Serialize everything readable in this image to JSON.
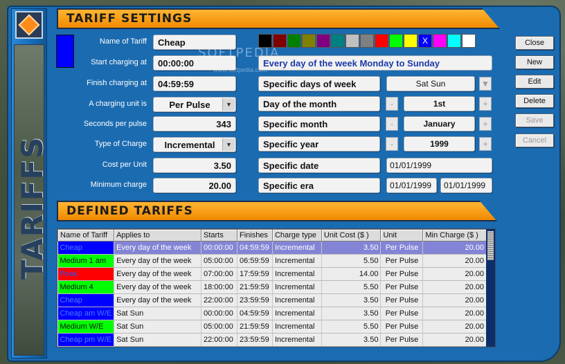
{
  "settings": {
    "title": "TARIFF SETTINGS",
    "labels": {
      "name": "Name of Tariff",
      "start": "Start charging at",
      "finish": "Finish charging at",
      "unit": "A charging unit is",
      "seconds": "Seconds per pulse",
      "type": "Type of Charge",
      "cost": "Cost per Unit",
      "min": "Minimum charge"
    },
    "values": {
      "name": "Cheap",
      "start": "00:00:00",
      "finish": "04:59:59",
      "unit": "Per Pulse",
      "seconds": "343",
      "type": "Incremental",
      "cost": "3.50",
      "min": "20.00"
    },
    "selected_color": "#0000ff",
    "colors": [
      "#000000",
      "#800000",
      "#008000",
      "#808000",
      "#800080",
      "#008080",
      "#c0c0c0",
      "#808080",
      "#ff0000",
      "#00ff00",
      "#ffff00",
      "#0000ff",
      "#ff00ff",
      "#00ffff",
      "#ffffff"
    ],
    "selected_color_mark": "X",
    "days_summary": "Every day of the week Monday to Sunday",
    "options": {
      "days_of_week": "Specific days of week",
      "day_of_month": "Day of the month",
      "month": "Specific month",
      "year": "Specific year",
      "date": "Specific date",
      "era": "Specific era"
    },
    "option_values": {
      "days_of_week": "Sat Sun",
      "day_of_month": "1st",
      "month": "January",
      "year": "1999",
      "date": "01/01/1999",
      "era_from": "01/01/1999",
      "era_to": "01/01/1999"
    },
    "stepper_minus": "-",
    "stepper_plus": "+",
    "watermark": "SOFTPEDIA",
    "watermark_sub": "www.softpedia.com"
  },
  "buttons": {
    "close": "Close",
    "new": "New",
    "edit": "Edit",
    "delete": "Delete",
    "save": "Save",
    "cancel": "Cancel"
  },
  "sidebar": {
    "title": "TARIFFS"
  },
  "defined": {
    "title": "DEFINED TARIFFS",
    "columns": [
      "Name of Tariff",
      "Applies to",
      "Starts",
      "Finishes",
      "Charge type",
      "Unit Cost ($ )",
      "Unit",
      "Min Charge ($ )"
    ],
    "rows": [
      {
        "name": "Cheap",
        "color": "#0000ff",
        "applies": "Every day of the week",
        "starts": "00:00:00",
        "finishes": "04:59:59",
        "type": "Incremental",
        "cost": "3.50",
        "unit": "Per Pulse",
        "min": "20.00"
      },
      {
        "name": "Medium 1 am",
        "color": "#00ff00",
        "applies": "Every day of the week",
        "starts": "05:00:00",
        "finishes": "06:59:59",
        "type": "Incremental",
        "cost": "5.50",
        "unit": "Per Pulse",
        "min": "20.00"
      },
      {
        "name": "Peak",
        "color": "#ff0000",
        "applies": "Every day of the week",
        "starts": "07:00:00",
        "finishes": "17:59:59",
        "type": "Incremental",
        "cost": "14.00",
        "unit": "Per Pulse",
        "min": "20.00"
      },
      {
        "name": "Medium 4",
        "color": "#00ff00",
        "applies": "Every day of the week",
        "starts": "18:00:00",
        "finishes": "21:59:59",
        "type": "Incremental",
        "cost": "5.50",
        "unit": "Per Pulse",
        "min": "20.00"
      },
      {
        "name": "Cheap",
        "color": "#0000ff",
        "applies": "Every day of the week",
        "starts": "22:00:00",
        "finishes": "23:59:59",
        "type": "Incremental",
        "cost": "3.50",
        "unit": "Per Pulse",
        "min": "20.00"
      },
      {
        "name": "Cheap am W/E",
        "color": "#0000ff",
        "applies": "Sat Sun",
        "starts": "00:00:00",
        "finishes": "04:59:59",
        "type": "Incremental",
        "cost": "3.50",
        "unit": "Per Pulse",
        "min": "20.00"
      },
      {
        "name": "Medium W/E",
        "color": "#00ff00",
        "applies": "Sat Sun",
        "starts": "05:00:00",
        "finishes": "21:59:59",
        "type": "Incremental",
        "cost": "5.50",
        "unit": "Per Pulse",
        "min": "20.00"
      },
      {
        "name": "Cheap pm W/E",
        "color": "#0000ff",
        "applies": "Sat Sun",
        "starts": "22:00:00",
        "finishes": "23:59:59",
        "type": "Incremental",
        "cost": "3.50",
        "unit": "Per Pulse",
        "min": "20.00"
      }
    ]
  }
}
